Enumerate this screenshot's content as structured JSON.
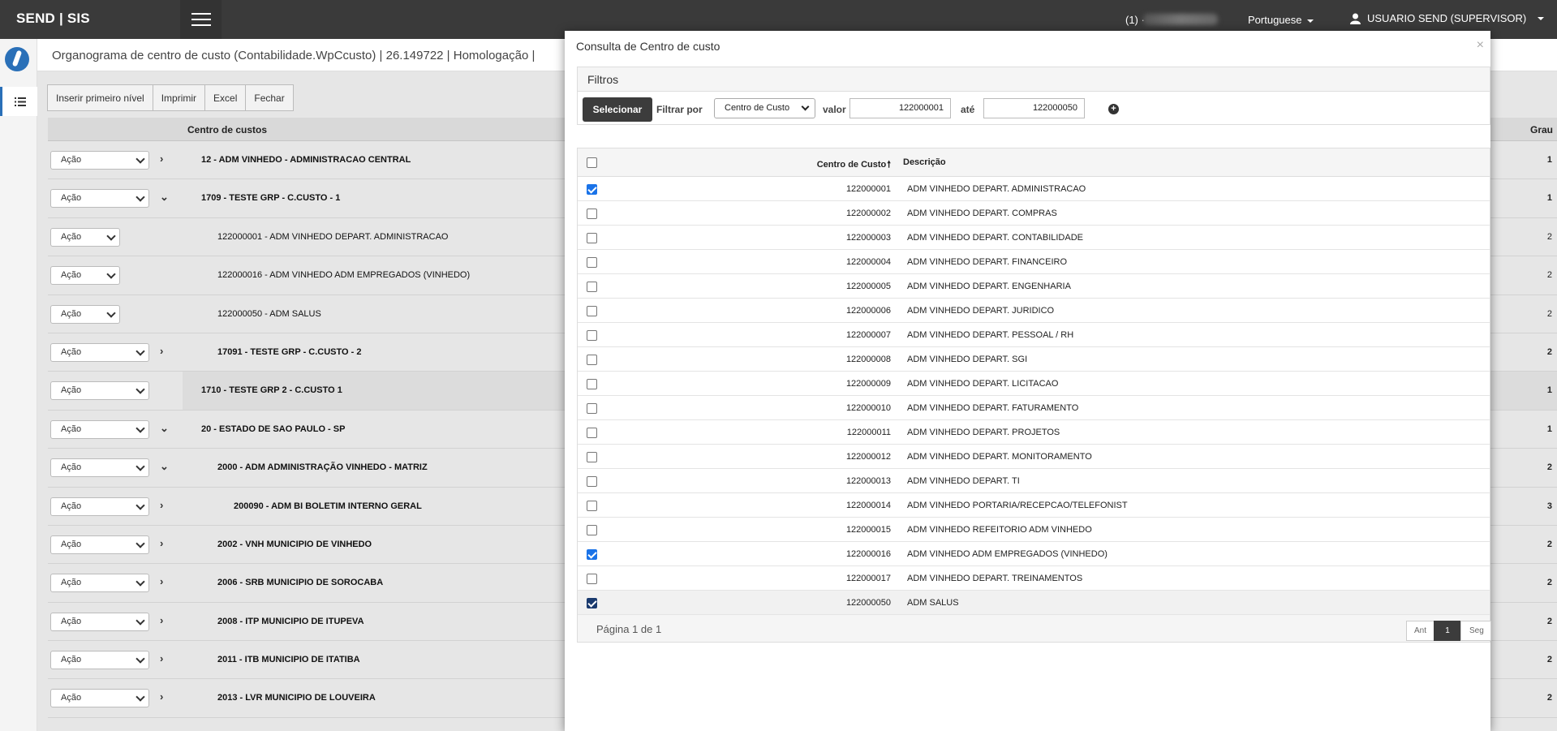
{
  "topbar": {
    "brand": "SEND | SIS",
    "notifications": "(1) ·",
    "language": "Portuguese",
    "user": "USUARIO SEND (SUPERVISOR)"
  },
  "page": {
    "title": "Organograma de centro de custo (Contabilidade.WpCcusto) | 26.149722 | Homologação |"
  },
  "toolbar": {
    "insert": "Inserir primeiro nível",
    "print": "Imprimir",
    "excel": "Excel",
    "close": "Fechar"
  },
  "grid": {
    "col_name": "Centro de custos",
    "col_grau": "Grau",
    "rows": [
      {
        "action": "Ação",
        "text": "12 - ADM VINHEDO - ADMINISTRACAO CENTRAL",
        "grau": "1"
      },
      {
        "action": "Ação",
        "text": "1709 - TESTE GRP - C.CUSTO - 1",
        "grau": "1"
      },
      {
        "action": "Ação",
        "text": "122000001 - ADM VINHEDO DEPART. ADMINISTRACAO",
        "grau": "2"
      },
      {
        "action": "Ação",
        "text": "122000016 - ADM VINHEDO ADM EMPREGADOS (VINHEDO)",
        "grau": "2"
      },
      {
        "action": "Ação",
        "text": "122000050 - ADM SALUS",
        "grau": "2"
      },
      {
        "action": "Ação",
        "text": "17091 - TESTE GRP - C.CUSTO - 2",
        "grau": "2"
      },
      {
        "action": "Ação",
        "text": "1710 - TESTE GRP 2 - C.CUSTO 1",
        "grau": "1"
      },
      {
        "action": "Ação",
        "text": "20 - ESTADO DE SAO PAULO - SP",
        "grau": "1"
      },
      {
        "action": "Ação",
        "text": "2000 - ADM ADMINISTRAÇÃO VINHEDO - MATRIZ",
        "grau": "2"
      },
      {
        "action": "Ação",
        "text": "200090 - ADM BI BOLETIM INTERNO GERAL",
        "grau": "3"
      },
      {
        "action": "Ação",
        "text": "2002 - VNH MUNICIPIO DE VINHEDO",
        "grau": "2"
      },
      {
        "action": "Ação",
        "text": "2006 - SRB MUNICIPIO DE SOROCABA",
        "grau": "2"
      },
      {
        "action": "Ação",
        "text": "2008 - ITP MUNICIPIO DE ITUPEVA",
        "grau": "2"
      },
      {
        "action": "Ação",
        "text": "2011 - ITB MUNICIPIO DE ITATIBA",
        "grau": "2"
      },
      {
        "action": "Ação",
        "text": "2013 - LVR MUNICIPIO DE LOUVEIRA",
        "grau": "2"
      }
    ]
  },
  "modal": {
    "title": "Consulta de Centro de custo",
    "close": "×",
    "filters": {
      "heading": "Filtros",
      "select_btn": "Selecionar",
      "filter_by": "Filtrar por",
      "filter_type": "Centro de Custo",
      "value_label": "valor",
      "value_from": "122000001",
      "until_label": "até",
      "value_to": "122000050",
      "add": "+"
    },
    "table": {
      "col_code": "Centro de Custo",
      "sort_indicator": "🠕",
      "col_desc": "Descrição",
      "rows": [
        {
          "code": "122000001",
          "desc": "ADM VINHEDO DEPART. ADMINISTRACAO",
          "checked": true
        },
        {
          "code": "122000002",
          "desc": "ADM VINHEDO DEPART. COMPRAS",
          "checked": false
        },
        {
          "code": "122000003",
          "desc": "ADM VINHEDO DEPART. CONTABILIDADE",
          "checked": false
        },
        {
          "code": "122000004",
          "desc": "ADM VINHEDO DEPART. FINANCEIRO",
          "checked": false
        },
        {
          "code": "122000005",
          "desc": "ADM VINHEDO DEPART. ENGENHARIA",
          "checked": false
        },
        {
          "code": "122000006",
          "desc": "ADM VINHEDO DEPART. JURIDICO",
          "checked": false
        },
        {
          "code": "122000007",
          "desc": "ADM VINHEDO DEPART. PESSOAL / RH",
          "checked": false
        },
        {
          "code": "122000008",
          "desc": "ADM VINHEDO DEPART. SGI",
          "checked": false
        },
        {
          "code": "122000009",
          "desc": "ADM VINHEDO DEPART. LICITACAO",
          "checked": false
        },
        {
          "code": "122000010",
          "desc": "ADM VINHEDO DEPART. FATURAMENTO",
          "checked": false
        },
        {
          "code": "122000011",
          "desc": "ADM VINHEDO DEPART. PROJETOS",
          "checked": false
        },
        {
          "code": "122000012",
          "desc": "ADM VINHEDO DEPART. MONITORAMENTO",
          "checked": false
        },
        {
          "code": "122000013",
          "desc": "ADM VINHEDO DEPART. TI",
          "checked": false
        },
        {
          "code": "122000014",
          "desc": "ADM VINHEDO PORTARIA/RECEPCAO/TELEFONIST",
          "checked": false
        },
        {
          "code": "122000015",
          "desc": "ADM VINHEDO REFEITORIO ADM VINHEDO",
          "checked": false
        },
        {
          "code": "122000016",
          "desc": "ADM VINHEDO ADM EMPREGADOS (VINHEDO)",
          "checked": true
        },
        {
          "code": "122000017",
          "desc": "ADM VINHEDO DEPART. TREINAMENTOS",
          "checked": false
        },
        {
          "code": "122000050",
          "desc": "ADM SALUS",
          "checked": true
        }
      ]
    },
    "pager": {
      "info": "Página 1 de 1",
      "prev": "Ant",
      "current": "1",
      "next": "Seg"
    }
  }
}
